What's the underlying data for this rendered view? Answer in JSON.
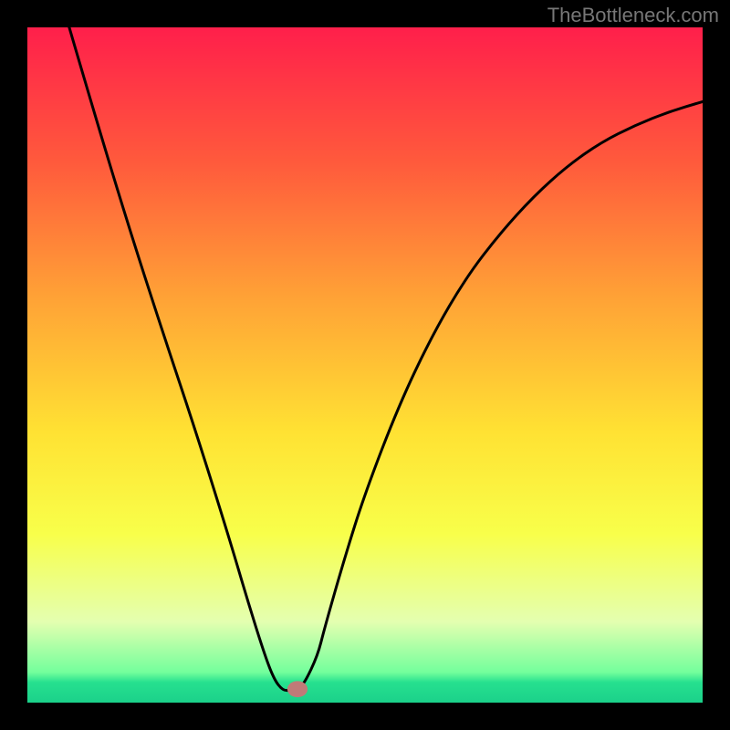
{
  "watermark": "TheBottleneck.com",
  "chart_data": {
    "type": "line",
    "title": "",
    "xlabel": "",
    "ylabel": "",
    "xlim": [
      0,
      1
    ],
    "ylim": [
      0,
      1
    ],
    "gradient_stops": [
      {
        "offset": 0.0,
        "color": "#ff1f4b"
      },
      {
        "offset": 0.2,
        "color": "#ff5a3c"
      },
      {
        "offset": 0.4,
        "color": "#ffa236"
      },
      {
        "offset": 0.6,
        "color": "#ffe233"
      },
      {
        "offset": 0.75,
        "color": "#f8ff4a"
      },
      {
        "offset": 0.88,
        "color": "#e4ffb0"
      },
      {
        "offset": 0.955,
        "color": "#73ff9c"
      },
      {
        "offset": 0.97,
        "color": "#26e08f"
      },
      {
        "offset": 1.0,
        "color": "#1bd18a"
      }
    ],
    "series": [
      {
        "name": "curve",
        "x": [
          0.062,
          0.1,
          0.15,
          0.2,
          0.25,
          0.3,
          0.325,
          0.35,
          0.365,
          0.378,
          0.39,
          0.4,
          0.41,
          0.43,
          0.44,
          0.47,
          0.5,
          0.55,
          0.6,
          0.65,
          0.7,
          0.75,
          0.8,
          0.85,
          0.9,
          0.95,
          1.0
        ],
        "y": [
          1.0,
          0.87,
          0.705,
          0.55,
          0.4,
          0.24,
          0.155,
          0.075,
          0.035,
          0.018,
          0.018,
          0.02,
          0.028,
          0.07,
          0.11,
          0.215,
          0.31,
          0.44,
          0.545,
          0.63,
          0.695,
          0.75,
          0.795,
          0.83,
          0.855,
          0.875,
          0.89
        ]
      }
    ],
    "marker": {
      "x": 0.4,
      "y": 0.02,
      "rx": 0.015,
      "ry": 0.012,
      "color": "#c07a78"
    }
  }
}
